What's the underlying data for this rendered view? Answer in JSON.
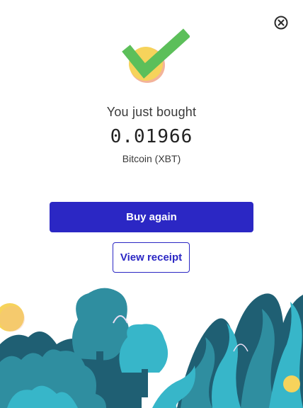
{
  "header": {
    "close_icon": "circle-x-icon"
  },
  "hero": {
    "icon": "checkmark-coin-icon",
    "check_color": "#5cbf5a",
    "coin_color": "#f6d35b"
  },
  "summary": {
    "label": "You just bought",
    "amount": "0.01966",
    "currency": "Bitcoin (XBT)"
  },
  "actions": {
    "buy_again_label": "Buy again",
    "view_receipt_label": "View receipt"
  },
  "colors": {
    "accent": "#2b27c4",
    "foliage_dark": "#1f5f73",
    "foliage_mid": "#2f8ea0",
    "foliage_light": "#37b6c9",
    "coin": "#f6d35b"
  }
}
